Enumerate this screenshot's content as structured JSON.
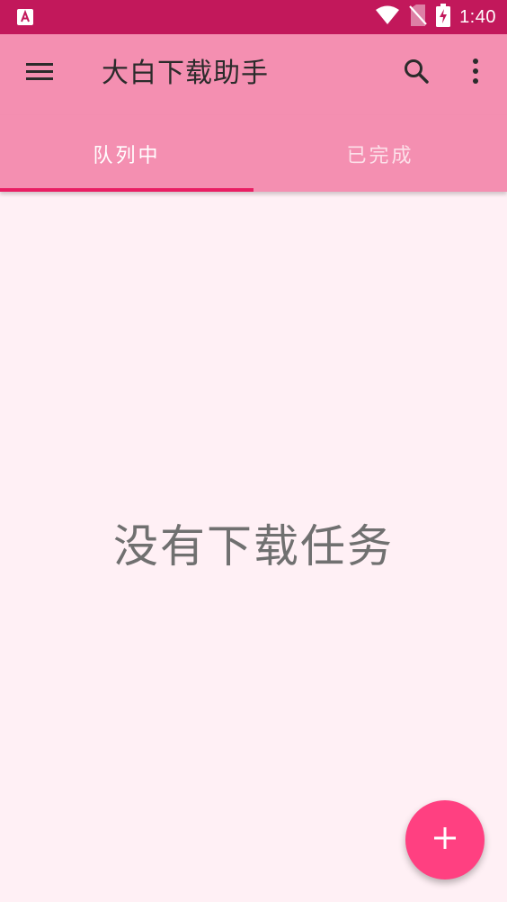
{
  "status_bar": {
    "time": "1:40",
    "app_icon": "android-app-icon",
    "icons": [
      "wifi-icon",
      "no-sim-icon",
      "battery-charging-icon"
    ]
  },
  "app_bar": {
    "title": "大白下载助手",
    "menu_icon": "menu-icon",
    "search_icon": "search-icon",
    "more_icon": "more-vert-icon"
  },
  "tabs": [
    {
      "label": "队列中",
      "selected": true
    },
    {
      "label": "已完成",
      "selected": false
    }
  ],
  "main": {
    "empty_message": "没有下载任务"
  },
  "fab": {
    "icon": "add-icon"
  },
  "colors": {
    "status_bar": "#c2185b",
    "primary": "#f48fb1",
    "accent": "#ff4081",
    "indicator": "#e91e63",
    "background": "#fff0f5"
  }
}
